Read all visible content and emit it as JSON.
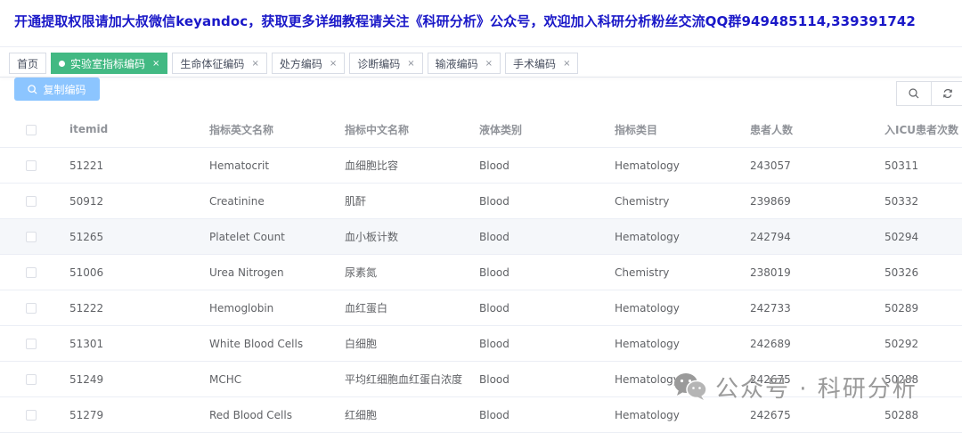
{
  "banner": {
    "text": "开通提取权限请加大叔微信keyandoc，获取更多详细教程请关注《科研分析》公众号，欢迎加入科研分析粉丝交流QQ群949485114,339391742"
  },
  "tabs": [
    {
      "label": "首页",
      "closable": false,
      "active": false
    },
    {
      "label": "实验室指标编码",
      "closable": true,
      "active": true
    },
    {
      "label": "生命体征编码",
      "closable": true,
      "active": false
    },
    {
      "label": "处方编码",
      "closable": true,
      "active": false
    },
    {
      "label": "诊断编码",
      "closable": true,
      "active": false
    },
    {
      "label": "输液编码",
      "closable": true,
      "active": false
    },
    {
      "label": "手术编码",
      "closable": true,
      "active": false
    }
  ],
  "toolbar": {
    "copy_label": "复制编码",
    "search_icon": "search-icon",
    "refresh_icon": "refresh-icon"
  },
  "table": {
    "columns": [
      "itemid",
      "指标英文名称",
      "指标中文名称",
      "液体类别",
      "指标类目",
      "患者人数",
      "入ICU患者次数"
    ],
    "rows": [
      [
        "51221",
        "Hematocrit",
        "血细胞比容",
        "Blood",
        "Hematology",
        "243057",
        "50311"
      ],
      [
        "50912",
        "Creatinine",
        "肌酐",
        "Blood",
        "Chemistry",
        "239869",
        "50332"
      ],
      [
        "51265",
        "Platelet Count",
        "血小板计数",
        "Blood",
        "Hematology",
        "242794",
        "50294"
      ],
      [
        "51006",
        "Urea Nitrogen",
        "尿素氮",
        "Blood",
        "Chemistry",
        "238019",
        "50326"
      ],
      [
        "51222",
        "Hemoglobin",
        "血红蛋白",
        "Blood",
        "Hematology",
        "242733",
        "50289"
      ],
      [
        "51301",
        "White Blood Cells",
        "白细胞",
        "Blood",
        "Hematology",
        "242689",
        "50292"
      ],
      [
        "51249",
        "MCHC",
        "平均红细胞血红蛋白浓度",
        "Blood",
        "Hematology",
        "242675",
        "50288"
      ],
      [
        "51279",
        "Red Blood Cells",
        "红细胞",
        "Blood",
        "Hematology",
        "242675",
        "50288"
      ]
    ],
    "hover_row": 2
  },
  "watermark": {
    "text": "公众号 · 科研分析",
    "icon": "wechat-icon"
  },
  "colors": {
    "banner": "#1a18c8",
    "active_tab": "#42b983",
    "copy_button": "#8cc5ff"
  }
}
